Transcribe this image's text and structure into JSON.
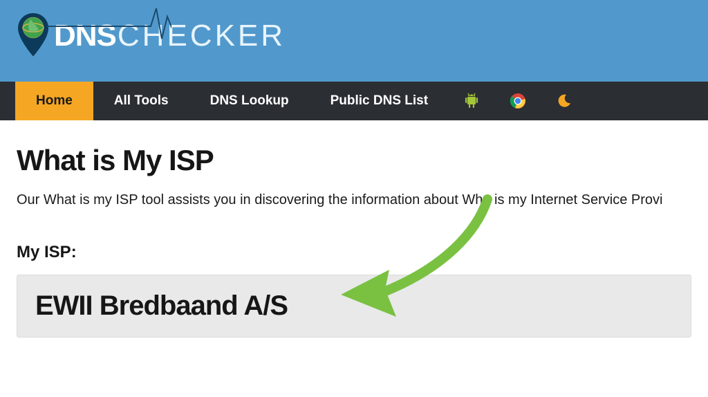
{
  "logo": {
    "part1": "DNS",
    "part2": "CHECKER"
  },
  "nav": {
    "items": [
      {
        "label": "Home",
        "active": true
      },
      {
        "label": "All Tools",
        "active": false
      },
      {
        "label": "DNS Lookup",
        "active": false
      },
      {
        "label": "Public DNS List",
        "active": false
      }
    ],
    "icons": [
      "android-icon",
      "chrome-icon",
      "moon-icon"
    ]
  },
  "page": {
    "title": "What is My ISP",
    "description": "Our What is my ISP tool assists you in discovering the information about Who is my Internet Service Provi",
    "isp_label": "My ISP:",
    "isp_value": "EWII Bredbaand A/S"
  },
  "colors": {
    "header_bg": "#5199cc",
    "nav_bg": "#2b2e33",
    "accent": "#f5a623",
    "arrow": "#7ac142"
  }
}
